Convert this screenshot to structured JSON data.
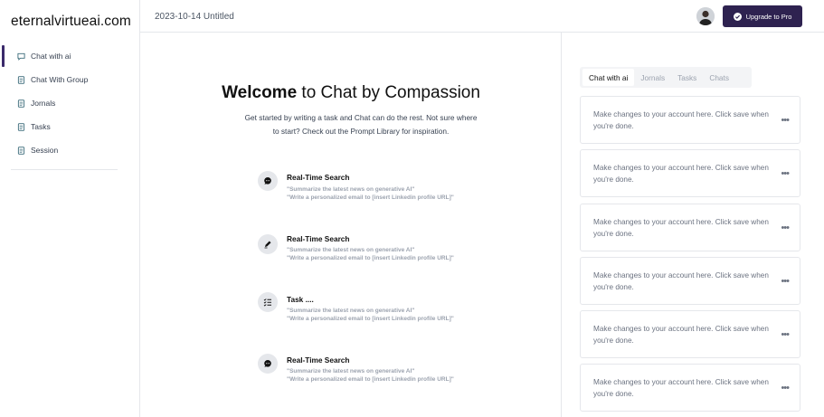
{
  "brand": "eternalvirtueai.com",
  "sidebar": {
    "items": [
      {
        "label": "Chat with ai",
        "icon": "chat-icon"
      },
      {
        "label": "Chat With Group",
        "icon": "document-icon"
      },
      {
        "label": "Jornals",
        "icon": "document-icon"
      },
      {
        "label": "Tasks",
        "icon": "document-icon"
      },
      {
        "label": "Session",
        "icon": "document-icon"
      }
    ]
  },
  "header": {
    "doc_title": "2023-10-14 Untitled",
    "upgrade_label": "Upgrade to Pro"
  },
  "main": {
    "welcome_bold": "Welcome",
    "welcome_rest": " to Chat by Compassion",
    "subtitle": "Get started by writing a task and Chat can do the rest. Not sure where to start? Check out the Prompt Library for inspiration.",
    "features": [
      {
        "title": "Real-Time Search",
        "icon": "chat-bubble-icon",
        "line1": "\"Summarize the latest news on generative AI\"",
        "line2": "\"Write a personalized email to [insert Linkedin profile URL]\""
      },
      {
        "title": "Real-Time Search",
        "icon": "pencil-icon",
        "line1": "\"Summarize the latest news on generative AI\"",
        "line2": "\"Write a personalized email to [insert Linkedin profile URL]\""
      },
      {
        "title": "Task ....",
        "icon": "checklist-icon",
        "line1": "\"Summarize the latest news on generative AI\"",
        "line2": "\"Write a personalized email to [insert Linkedin profile URL]\""
      },
      {
        "title": "Real-Time Search",
        "icon": "chat-bubble-icon",
        "line1": "\"Summarize the latest news on generative AI\"",
        "line2": "\"Write a personalized email to [insert Linkedin profile URL]\""
      }
    ]
  },
  "right_panel": {
    "tabs": [
      "Chat with ai",
      "Jornals",
      "Tasks",
      "Chats"
    ],
    "active_tab": "Chat with ai",
    "cards": [
      {
        "text": "Make changes to your account here. Click save when you're done.",
        "menu": "•••"
      },
      {
        "text": "Make changes to your account here. Click save when you're done.",
        "menu": "•••"
      },
      {
        "text": "Make changes to your account here. Click save when you're done.",
        "menu": "•••"
      },
      {
        "text": "Make changes to your account here. Click save when you're done.",
        "menu": "•••"
      },
      {
        "text": "Make changes to your account here. Click save when you're done.",
        "menu": "•••"
      },
      {
        "text": "Make changes to your account here. Click save when you're done.",
        "menu": "•••"
      }
    ]
  },
  "colors": {
    "accent": "#2e2250",
    "active_bar": "#3b2a6b"
  }
}
